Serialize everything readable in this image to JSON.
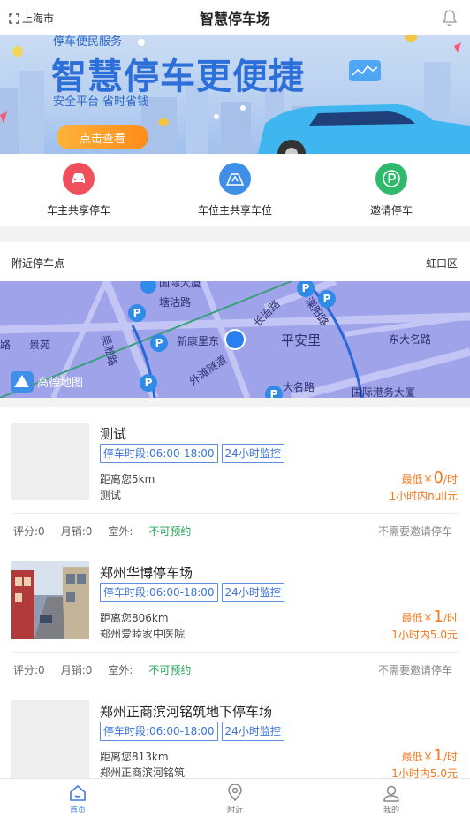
{
  "header": {
    "city": "上海市",
    "title": "智慧停车场"
  },
  "banner": {
    "subtitle": "停车便民服务",
    "headline": "智慧停车更便捷",
    "tagline": "安全平台 省时省钱",
    "button": "点击查看"
  },
  "quick_actions": [
    {
      "label": "车主共享停车",
      "icon": "car-icon",
      "color": "#f0505c"
    },
    {
      "label": "车位主共享车位",
      "icon": "parking-space-icon",
      "color": "#3f8fe8"
    },
    {
      "label": "邀请停车",
      "icon": "parking-p-icon",
      "color": "#2fb96a"
    }
  ],
  "nearby": {
    "title": "附近停车点",
    "district": "虹口区"
  },
  "map": {
    "labels": [
      "国际大厦",
      "塘沽路",
      "新康里东",
      "长治路",
      "溧阳路",
      "平安里",
      "东大名路",
      "大名路",
      "吴淞路",
      "外滩隧道",
      "景苑",
      "国际港务大厦",
      "路"
    ],
    "provider": "高德地图"
  },
  "lots": [
    {
      "name": "测试",
      "tags": [
        "停车时段:06:00-18:00",
        "24小时监控"
      ],
      "distance": "距离您5km",
      "address": "测试",
      "price_prefix": "最低￥",
      "price": "0",
      "price_unit": "/时",
      "price_note": "1小时内null元",
      "rating": "评分:0",
      "sales": "月销:0",
      "outdoor_label": "室外:",
      "outdoor_value": "不可预约",
      "invite": "不需要邀请停车",
      "has_photo": false
    },
    {
      "name": "郑州华博停车场",
      "tags": [
        "停车时段:06:00-18:00",
        "24小时监控"
      ],
      "distance": "距离您806km",
      "address": "郑州爱睦家中医院",
      "price_prefix": "最低￥",
      "price": "1",
      "price_unit": "/时",
      "price_note": "1小时内5.0元",
      "rating": "评分:0",
      "sales": "月销:0",
      "outdoor_label": "室外:",
      "outdoor_value": "不可预约",
      "invite": "不需要邀请停车",
      "has_photo": true
    },
    {
      "name": "郑州正商滨河铭筑地下停车场",
      "tags": [
        "停车时段:06:00-18:00",
        "24小时监控"
      ],
      "distance": "距离您813km",
      "address": "郑州正商滨河铭筑",
      "price_prefix": "最低￥",
      "price": "1",
      "price_unit": "/时",
      "price_note": "1小时内5.0元",
      "rating": "",
      "sales": "",
      "outdoor_label": "",
      "outdoor_value": "",
      "invite": "",
      "has_photo": false
    }
  ],
  "tabbar": [
    {
      "label": "首页",
      "icon": "home-icon",
      "active": true
    },
    {
      "label": "附近",
      "icon": "location-icon",
      "active": false
    },
    {
      "label": "我的",
      "icon": "user-icon",
      "active": false
    }
  ]
}
